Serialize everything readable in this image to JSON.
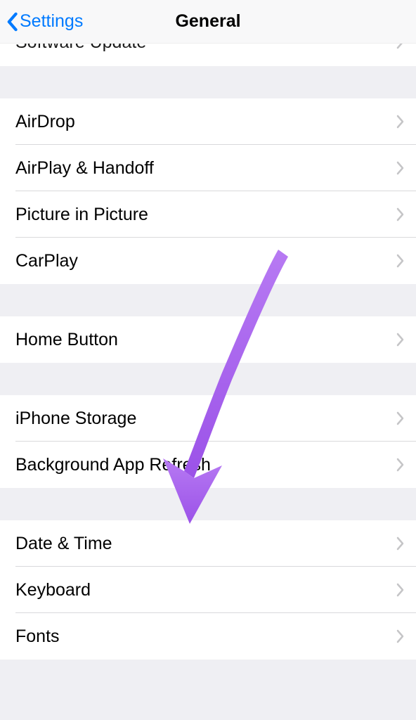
{
  "header": {
    "back_label": "Settings",
    "title": "General"
  },
  "groups": [
    {
      "rows": [
        {
          "label": "Software Update",
          "partial": true
        }
      ]
    },
    {
      "rows": [
        {
          "label": "AirDrop"
        },
        {
          "label": "AirPlay & Handoff"
        },
        {
          "label": "Picture in Picture"
        },
        {
          "label": "CarPlay"
        }
      ]
    },
    {
      "rows": [
        {
          "label": "Home Button"
        }
      ]
    },
    {
      "rows": [
        {
          "label": "iPhone Storage"
        },
        {
          "label": "Background App Refresh"
        }
      ]
    },
    {
      "rows": [
        {
          "label": "Date & Time"
        },
        {
          "label": "Keyboard"
        },
        {
          "label": "Fonts"
        }
      ]
    }
  ],
  "annotation": {
    "arrow_color": "#a866f0"
  }
}
